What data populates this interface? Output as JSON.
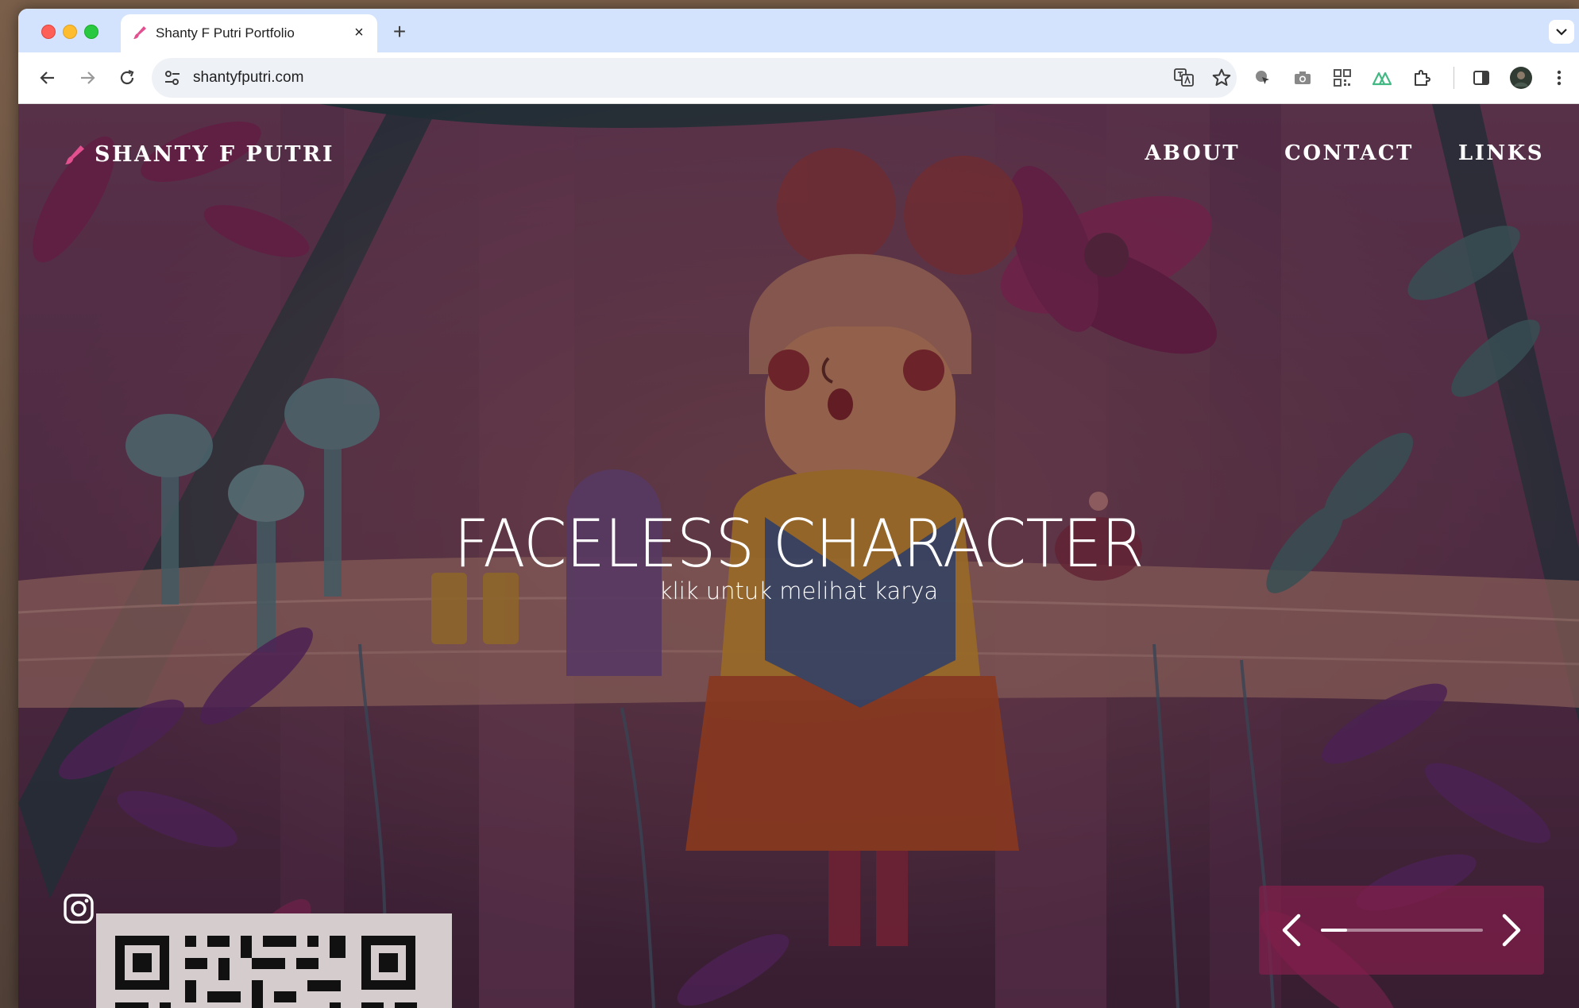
{
  "browser": {
    "tab_title": "Shanty F Putri Portfolio",
    "tab_close": "×",
    "new_tab": "+",
    "url": "shantyfputri.com",
    "accent": "#d3e3fd"
  },
  "site": {
    "brand": "SHANTY F PUTRI",
    "nav": [
      {
        "label": "ABOUT"
      },
      {
        "label": "CONTACT"
      },
      {
        "label": "LINKS"
      }
    ],
    "headline": "FACELESS CHARACTER",
    "subline": "klik untuk melihat karya",
    "brand_color": "#e2508f",
    "slider": {
      "progress": 0.16
    }
  },
  "icons": {
    "brand": "paint-brush-icon",
    "social": "instagram-icon",
    "prev": "chevron-left-icon",
    "next": "chevron-right-icon"
  }
}
